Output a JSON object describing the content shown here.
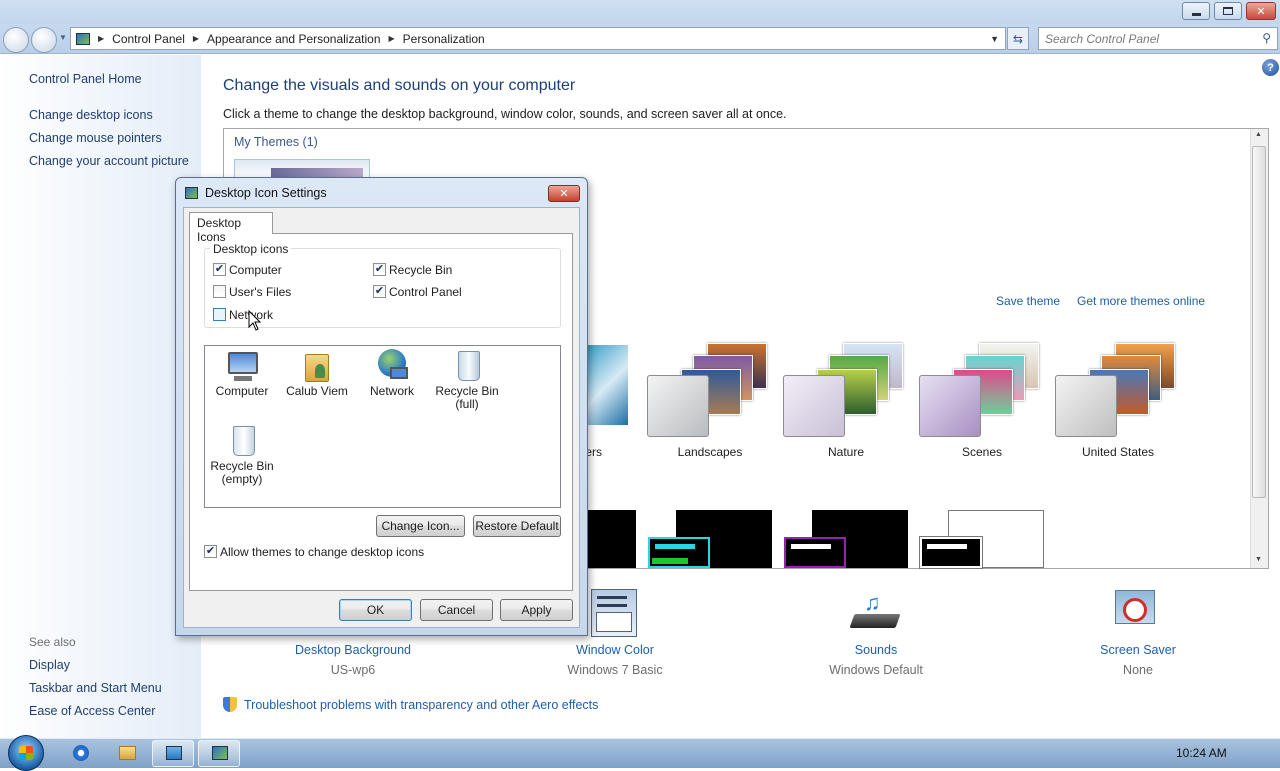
{
  "address": {
    "crumbs": [
      "Control Panel",
      "Appearance and Personalization",
      "Personalization"
    ],
    "search_placeholder": "Search Control Panel"
  },
  "left_pane": {
    "home": "Control Panel Home",
    "links": [
      "Change desktop icons",
      "Change mouse pointers",
      "Change your account picture"
    ],
    "see_also_label": "See also",
    "see_also": [
      "Display",
      "Taskbar and Start Menu",
      "Ease of Access Center"
    ]
  },
  "main": {
    "title": "Change the visuals and sounds on your computer",
    "subtitle": "Click a theme to change the desktop background, window color, sounds, and screen saver all at once.",
    "my_themes": "My Themes (1)",
    "save_theme": "Save theme",
    "get_more_themes": "Get more themes online",
    "themes": [
      {
        "label": "ers"
      },
      {
        "label": "Landscapes"
      },
      {
        "label": "Nature"
      },
      {
        "label": "Scenes"
      },
      {
        "label": "United States"
      }
    ],
    "bottom_items": [
      {
        "label": "Desktop Background",
        "sub": "US-wp6"
      },
      {
        "label": "Window Color",
        "sub": "Windows 7 Basic"
      },
      {
        "label": "Sounds",
        "sub": "Windows Default"
      },
      {
        "label": "Screen Saver",
        "sub": "None"
      }
    ],
    "troubleshoot": "Troubleshoot problems with transparency and other Aero effects"
  },
  "dialog": {
    "title": "Desktop Icon Settings",
    "tab": "Desktop Icons",
    "group_label": "Desktop icons",
    "checkboxes": [
      {
        "label": "Computer",
        "checked": true
      },
      {
        "label": "Recycle Bin",
        "checked": true
      },
      {
        "label": "User's Files",
        "checked": false
      },
      {
        "label": "Control Panel",
        "checked": true
      },
      {
        "label": "Network",
        "checked": false
      }
    ],
    "icons": [
      {
        "label": "Computer"
      },
      {
        "label": "Calub Viem"
      },
      {
        "label": "Network"
      },
      {
        "label": "Recycle Bin (full)"
      },
      {
        "label": "Recycle Bin (empty)"
      }
    ],
    "change_icon": "Change Icon...",
    "restore_default": "Restore Default",
    "allow_themes": "Allow themes to change desktop icons",
    "allow_themes_checked": true,
    "ok": "OK",
    "cancel": "Cancel",
    "apply": "Apply"
  },
  "taskbar": {
    "clock": "10:24 AM"
  },
  "colors": {
    "link": "#1f5ea8",
    "title": "#1e3f78"
  }
}
